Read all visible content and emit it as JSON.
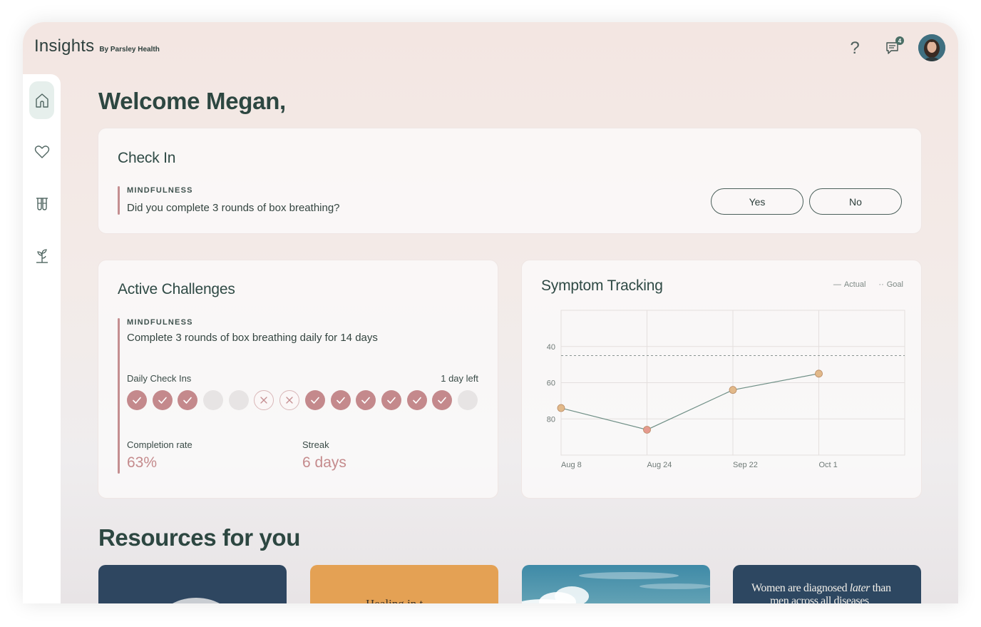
{
  "header": {
    "brand": "Insights",
    "brand_sub": "By Parsley Health",
    "notification_count": "4",
    "icons": [
      "help-icon",
      "chat-icon",
      "avatar"
    ]
  },
  "sidebar": {
    "items": [
      {
        "name": "home",
        "icon": "home-icon",
        "active": true
      },
      {
        "name": "heart",
        "icon": "heart-icon",
        "active": false
      },
      {
        "name": "labs",
        "icon": "test-tubes-icon",
        "active": false
      },
      {
        "name": "growth",
        "icon": "plant-icon",
        "active": false
      }
    ]
  },
  "welcome": "Welcome Megan,",
  "check_in": {
    "title": "Check In",
    "category": "MINDFULNESS",
    "question": "Did you complete 3 rounds of box breathing?",
    "yes": "Yes",
    "no": "No"
  },
  "challenges": {
    "title": "Active Challenges",
    "category": "MINDFULNESS",
    "description": "Complete 3 rounds of box breathing daily for 14 days",
    "daily_label": "Daily Check Ins",
    "days_left": "1 day left",
    "checkins": [
      "done",
      "done",
      "done",
      "empty",
      "empty",
      "missed",
      "missed",
      "done",
      "done",
      "done",
      "done",
      "done",
      "done",
      "empty"
    ],
    "completion_label": "Completion rate",
    "completion_value": "63%",
    "streak_label": "Streak",
    "streak_value": "6 days"
  },
  "symptom": {
    "title": "Symptom Tracking",
    "legend_actual": "Actual",
    "legend_goal": "Goal",
    "accent": "#e2b98a",
    "low_point_color": "#e59a8e",
    "line_color": "#6f8f86"
  },
  "chart_data": {
    "type": "line",
    "title": "Symptom Tracking",
    "x": [
      "Aug 8",
      "Aug 24",
      "Sep 22",
      "Oct 1"
    ],
    "y_ticks": [
      40,
      60,
      80
    ],
    "ylim": [
      20,
      100
    ],
    "y_inverted": true,
    "series": [
      {
        "name": "Actual",
        "values": [
          74,
          86,
          64,
          55
        ]
      },
      {
        "name": "Goal",
        "values": [
          45,
          45,
          45,
          45
        ]
      }
    ],
    "legend": "top-right",
    "grid": true
  },
  "resources": {
    "title": "Resources for you",
    "cards": [
      {
        "kind": "image",
        "color": "#2e4660",
        "text": ""
      },
      {
        "kind": "text",
        "color": "#e4a154",
        "text": "Healing in t"
      },
      {
        "kind": "image",
        "color": "#4f8fa6",
        "text": ""
      },
      {
        "kind": "text",
        "color": "#2d4761",
        "text_before": "Women are diagnosed ",
        "text_italic": "later",
        "text_after": " than",
        "line2": "men across all diseases"
      }
    ]
  }
}
